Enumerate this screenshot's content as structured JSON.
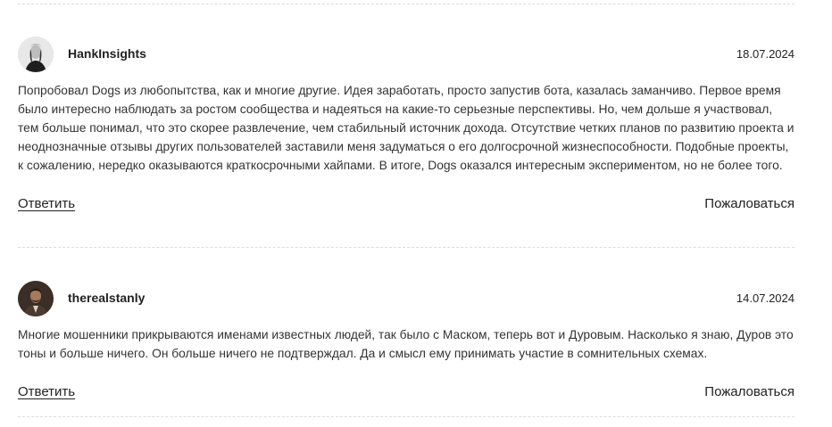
{
  "comments": [
    {
      "author": "HankInsights",
      "date": "18.07.2024",
      "text": "Попробовал Dogs из любопытства, как и многие другие. Идея заработать, просто запустив бота, казалась заманчиво. Первое время было интересно наблюдать за ростом сообщества и надеяться на какие-то серьезные перспективы. Но, чем дольше я участвовал, тем больше понимал, что это скорее развлечение, чем стабильный источник дохода. Отсутствие четких планов по развитию проекта и неоднозначные отзывы других пользователей заставили меня задуматься о его долгосрочной жизнеспособности. Подобные проекты, к сожалению, нередко оказываются краткосрочными хайпами. В итоге, Dogs оказался интересным экспериментом, но не более того.",
      "reply_label": "Ответить",
      "report_label": "Пожаловаться"
    },
    {
      "author": "therealstanly",
      "date": "14.07.2024",
      "text": "Многие мошенники прикрываются именами известных людей, так было с Маском, теперь вот и Дуровым. Насколько я знаю, Дуров это тоны и больше ничего. Он больше ничего не подтверждал. Да и смысл ему принимать участие в сомнительных схемах.",
      "reply_label": "Ответить",
      "report_label": "Пожаловаться"
    }
  ]
}
